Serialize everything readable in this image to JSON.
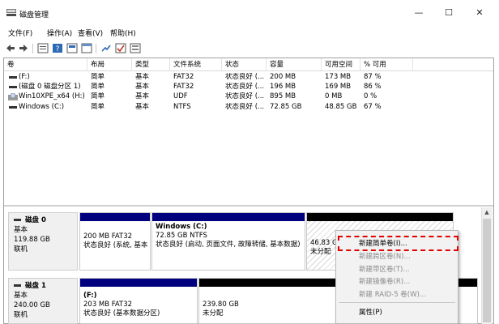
{
  "window": {
    "title": "磁盘管理",
    "minimize_glyph": "—",
    "maximize_glyph": "☐",
    "close_glyph": "✕"
  },
  "menu": [
    {
      "label": "文件(F)"
    },
    {
      "label": "操作(A)"
    },
    {
      "label": "查看(V)"
    },
    {
      "label": "帮助(H)"
    }
  ],
  "toolbar": {
    "icons": [
      "back-arrow-icon",
      "forward-arrow-icon",
      "list-view-icon",
      "help-icon",
      "disk-properties-icon",
      "checkmark-icon",
      "window-icon"
    ]
  },
  "volumes": {
    "headers": [
      "卷",
      "布局",
      "类型",
      "文件系统",
      "状态",
      "容量",
      "可用空间",
      "% 可用"
    ],
    "rows": [
      [
        "(F:)",
        "简单",
        "基本",
        "FAT32",
        "状态良好 (...",
        "200 MB",
        "173 MB",
        "87 %"
      ],
      [
        "(磁盘 0 磁盘分区 1)",
        "简单",
        "基本",
        "FAT32",
        "状态良好 (...",
        "196 MB",
        "169 MB",
        "86 %"
      ],
      [
        "Win10XPE_x64 (H:)",
        "简单",
        "基本",
        "UDF",
        "状态良好 (...",
        "895 MB",
        "0 MB",
        "0 %"
      ],
      [
        "Windows (C:)",
        "简单",
        "基本",
        "NTFS",
        "状态良好 (...",
        "72.85 GB",
        "48.85 GB",
        "67 %"
      ]
    ]
  },
  "disks": [
    {
      "name": "磁盘 0",
      "type": "基本",
      "size": "119.88 GB",
      "status": "联机",
      "partitions": [
        {
          "title": "",
          "line1": "200 MB FAT32",
          "line2": "状态良好 (系统, 基本"
        },
        {
          "title": "Windows  (C:)",
          "line1": "72.85 GB NTFS",
          "line2": "状态良好 (启动, 页面文件, 故障转储, 基本数据)"
        },
        {
          "title": "",
          "line1": "46.83 GB",
          "line2": "未分配"
        }
      ]
    },
    {
      "name": "磁盘 1",
      "type": "基本",
      "size": "240.00 GB",
      "status": "联机",
      "partitions": [
        {
          "title": "(F:)",
          "line1": "203 MB FAT32",
          "line2": "状态良好 (基本数据分区)"
        },
        {
          "title": "",
          "line1": "239.80 GB",
          "line2": "未分配"
        }
      ]
    }
  ],
  "context_menu": {
    "items": [
      {
        "label": "新建简单卷(I)...",
        "enabled": true
      },
      {
        "label": "新建跨区卷(N)...",
        "enabled": false
      },
      {
        "label": "新建带区卷(T)...",
        "enabled": false
      },
      {
        "label": "新建镜像卷(R)...",
        "enabled": false
      },
      {
        "label": "新建 RAID-5 卷(W)...",
        "enabled": false
      },
      {
        "label": "属性(P)",
        "enabled": true
      }
    ]
  },
  "colors": {
    "partition_stripe": "#00007f",
    "unallocated_stripe": "#000000",
    "highlight": "#e00000"
  }
}
